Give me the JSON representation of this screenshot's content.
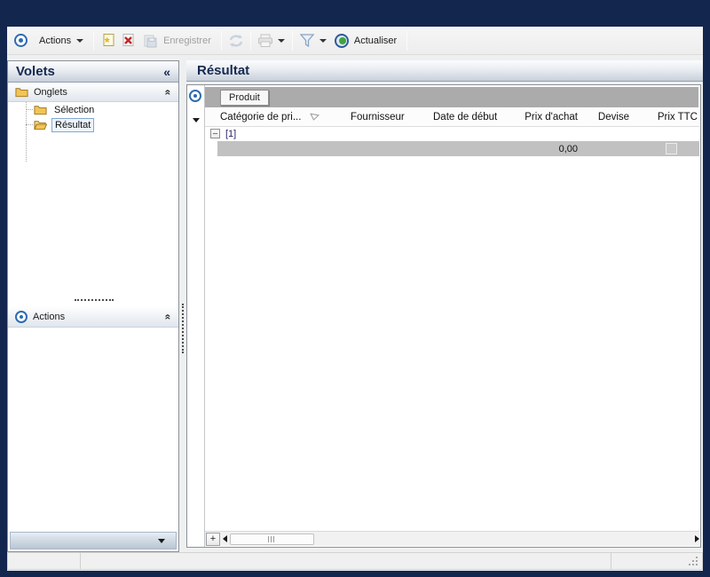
{
  "colors": {
    "frame_navy": "#13264d",
    "accent_blue": "#2e6bb1",
    "refresh_green": "#3fa43f",
    "folder_yellow": "#f2c455",
    "group_band_gray": "#ababab",
    "selected_row_gray": "#c1c1c1",
    "selection_border": "#84a7d3"
  },
  "toolbar": {
    "actions_label": "Actions",
    "save_label": "Enregistrer",
    "refresh_label": "Actualiser"
  },
  "sidebar": {
    "title": "Volets",
    "collapse_left_glyph": "«",
    "sections": [
      {
        "label": "Onglets"
      },
      {
        "label": "Actions"
      }
    ],
    "tree": [
      {
        "label": "Sélection",
        "selected": false
      },
      {
        "label": "Résultat",
        "selected": true
      }
    ]
  },
  "main": {
    "title": "Résultat",
    "grid": {
      "group_field": "Produit",
      "columns": [
        {
          "label": "Catégorie de pri...",
          "align": "left",
          "sorted": true
        },
        {
          "label": "Fournisseur",
          "align": "left"
        },
        {
          "label": "Date de début",
          "align": "left"
        },
        {
          "label": "Prix d'achat",
          "align": "right"
        },
        {
          "label": "Devise",
          "align": "center"
        },
        {
          "label": "Prix TTC",
          "align": "right"
        }
      ],
      "group_row": {
        "collapse_glyph": "−",
        "label": "[1]"
      },
      "row": {
        "prix_achat": "0,00",
        "prix_ttc_checked": false
      },
      "add_label": "+"
    }
  }
}
